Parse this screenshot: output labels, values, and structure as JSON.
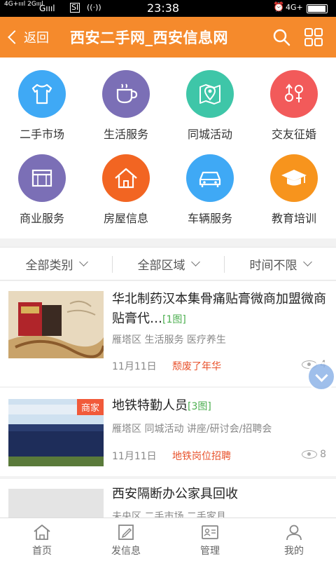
{
  "status_bar": {
    "signal_left": "4G+ıııl 2Gıııl",
    "signal_g": "Gıııl",
    "time": "23:38",
    "network": "4G+",
    "icons": [
      "sim-icon",
      "nfc-icon",
      "alarm-icon",
      "battery-icon"
    ]
  },
  "header": {
    "back_label": "返回",
    "title": "西安二手网_西安信息网",
    "accent_color": "#f58a2c",
    "icons": [
      "search-icon",
      "grid-menu-icon"
    ]
  },
  "categories": [
    {
      "label": "二手市场",
      "color": "#3fa9f5",
      "icon": "tshirt-icon"
    },
    {
      "label": "生活服务",
      "color": "#7b6fb6",
      "icon": "coffee-cup-icon"
    },
    {
      "label": "同城活动",
      "color": "#3ec6a8",
      "icon": "map-pin-icon"
    },
    {
      "label": "交友征婚",
      "color": "#f25a5a",
      "icon": "gender-icon"
    },
    {
      "label": "商业服务",
      "color": "#7b6fb6",
      "icon": "shop-icon"
    },
    {
      "label": "房屋信息",
      "color": "#f26522",
      "icon": "house-icon"
    },
    {
      "label": "车辆服务",
      "color": "#3fa9f5",
      "icon": "car-icon"
    },
    {
      "label": "教育培训",
      "color": "#f7941d",
      "icon": "graduation-cap-icon"
    }
  ],
  "filters": [
    {
      "label": "全部类别"
    },
    {
      "label": "全部区域"
    },
    {
      "label": "时间不限"
    }
  ],
  "listings": [
    {
      "title": "华北制药汉本集骨痛贴膏微商加盟微商贴膏代…",
      "image_count": "[1图]",
      "meta": "雁塔区 生活服务 医疗养生",
      "date": "11月11日",
      "tag": "颓废了年华",
      "views": "4"
    },
    {
      "title": "地铁特勤人员",
      "image_count": "[3图]",
      "badge": "商家",
      "meta": "雁塔区 同城活动 讲座/研讨会/招聘会",
      "date": "11月11日",
      "tag": "地铁岗位招聘",
      "views": "8"
    },
    {
      "title": "西安隔断办公家具回收",
      "meta": "未央区 二手市场 二手家具"
    }
  ],
  "bottom_nav": [
    {
      "label": "首页",
      "icon": "home-icon"
    },
    {
      "label": "发信息",
      "icon": "edit-icon"
    },
    {
      "label": "管理",
      "icon": "manage-icon"
    },
    {
      "label": "我的",
      "icon": "user-icon"
    }
  ]
}
